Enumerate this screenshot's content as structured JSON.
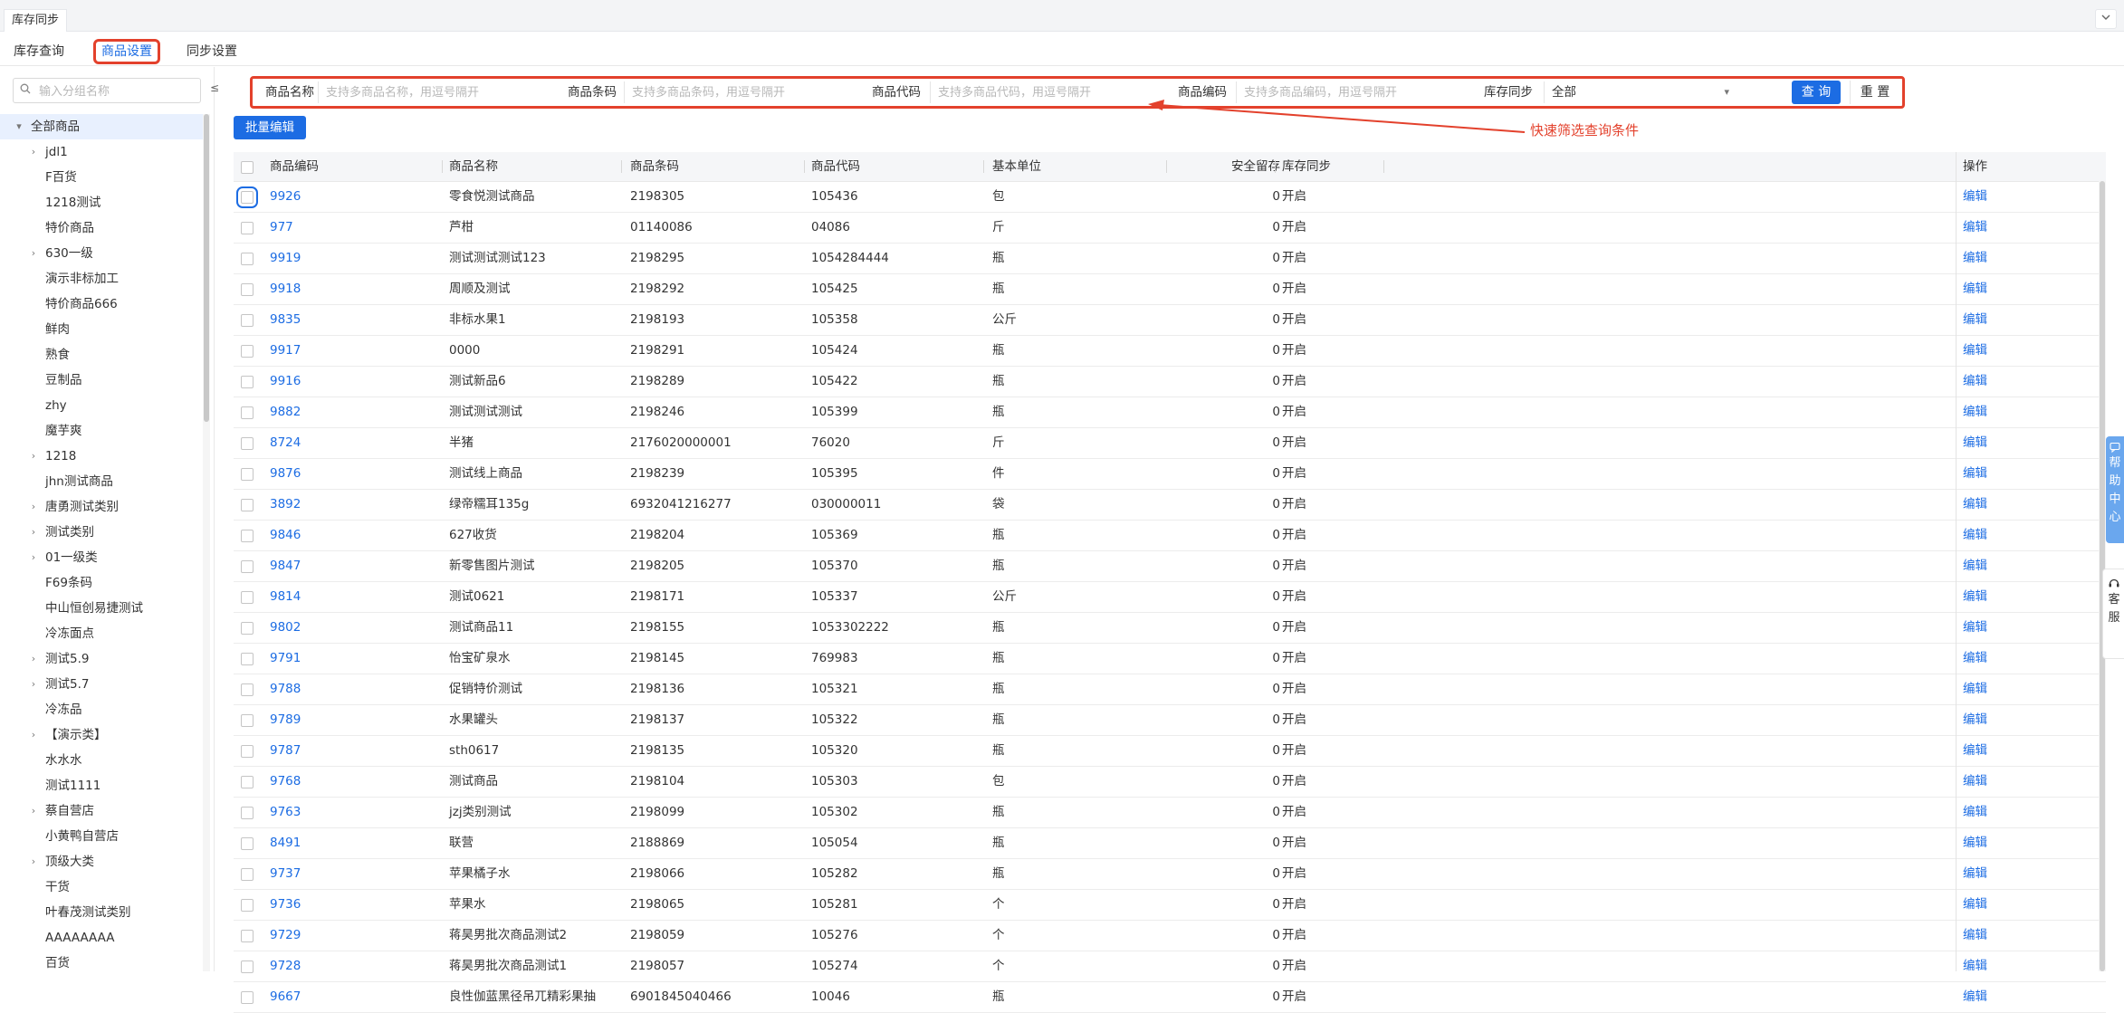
{
  "top_tab": "库存同步",
  "tabs": [
    "库存查询",
    "商品设置",
    "同步设置"
  ],
  "sidebar": {
    "search_placeholder": "输入分组名称",
    "toggle_label": "≤",
    "root": "全部商品",
    "groups": [
      {
        "label": "jdl1",
        "expandable": true
      },
      {
        "label": "F百货",
        "expandable": false
      },
      {
        "label": "1218测试",
        "expandable": false
      },
      {
        "label": "特价商品",
        "expandable": false
      },
      {
        "label": "630一级",
        "expandable": true
      },
      {
        "label": "演示非标加工",
        "expandable": false
      },
      {
        "label": "特价商品666",
        "expandable": false
      },
      {
        "label": "鲜肉",
        "expandable": false
      },
      {
        "label": "熟食",
        "expandable": false
      },
      {
        "label": "豆制品",
        "expandable": false
      },
      {
        "label": "zhy",
        "expandable": false
      },
      {
        "label": "魔芋爽",
        "expandable": false
      },
      {
        "label": "1218",
        "expandable": true
      },
      {
        "label": "jhn测试商品",
        "expandable": false
      },
      {
        "label": "唐勇测试类别",
        "expandable": true
      },
      {
        "label": "测试类别",
        "expandable": true
      },
      {
        "label": "01一级类",
        "expandable": true
      },
      {
        "label": "F69条码",
        "expandable": false
      },
      {
        "label": "中山恒创易捷测试",
        "expandable": false
      },
      {
        "label": "冷冻面点",
        "expandable": false
      },
      {
        "label": "测试5.9",
        "expandable": true
      },
      {
        "label": "测试5.7",
        "expandable": true
      },
      {
        "label": "冷冻品",
        "expandable": false
      },
      {
        "label": "【演示类】",
        "expandable": true
      },
      {
        "label": "水水水",
        "expandable": false
      },
      {
        "label": "测试1111",
        "expandable": false
      },
      {
        "label": "蔡自营店",
        "expandable": true
      },
      {
        "label": "小黄鸭自营店",
        "expandable": false
      },
      {
        "label": "顶级大类",
        "expandable": true
      },
      {
        "label": "干货",
        "expandable": false
      },
      {
        "label": "叶春茂测试类别",
        "expandable": false
      },
      {
        "label": "AAAAAAAA",
        "expandable": false
      },
      {
        "label": "百货",
        "expandable": false
      }
    ]
  },
  "filters": {
    "name_label": "商品名称",
    "name_placeholder": "支持多商品名称，用逗号隔开",
    "barcode_label": "商品条码",
    "barcode_placeholder": "支持多商品条码，用逗号隔开",
    "code_label": "商品代码",
    "code_placeholder": "支持多商品代码，用逗号隔开",
    "number_label": "商品编码",
    "number_placeholder": "支持多商品编码，用逗号隔开",
    "sync_label": "库存同步",
    "sync_value": "全部",
    "query_label": "查 询",
    "reset_label": "重 置"
  },
  "annotation": "快速筛选查询条件",
  "batch_edit_label": "批量编辑",
  "table": {
    "columns": [
      "商品编码",
      "商品名称",
      "商品条码",
      "商品代码",
      "基本单位",
      "安全留存",
      "库存同步",
      "操作"
    ],
    "edit_label": "编辑",
    "rows": [
      [
        "9926",
        "零食悦测试商品",
        "2198305",
        "105436",
        "包",
        "0",
        "开启"
      ],
      [
        "977",
        "芦柑",
        "01140086",
        "04086",
        "斤",
        "0",
        "开启"
      ],
      [
        "9919",
        "测试测试测试123",
        "2198295",
        "1054284444",
        "瓶",
        "0",
        "开启"
      ],
      [
        "9918",
        "周顺及测试",
        "2198292",
        "105425",
        "瓶",
        "0",
        "开启"
      ],
      [
        "9835",
        "非标水果1",
        "2198193",
        "105358",
        "公斤",
        "0",
        "开启"
      ],
      [
        "9917",
        "0000",
        "2198291",
        "105424",
        "瓶",
        "0",
        "开启"
      ],
      [
        "9916",
        "测试新品6",
        "2198289",
        "105422",
        "瓶",
        "0",
        "开启"
      ],
      [
        "9882",
        "测试测试测试",
        "2198246",
        "105399",
        "瓶",
        "0",
        "开启"
      ],
      [
        "8724",
        "半猪",
        "2176020000001",
        "76020",
        "斤",
        "0",
        "开启"
      ],
      [
        "9876",
        "测试线上商品",
        "2198239",
        "105395",
        "件",
        "0",
        "开启"
      ],
      [
        "3892",
        "绿帝糯耳135g",
        "6932041216277",
        "030000011",
        "袋",
        "0",
        "开启"
      ],
      [
        "9846",
        "627收货",
        "2198204",
        "105369",
        "瓶",
        "0",
        "开启"
      ],
      [
        "9847",
        "新零售图片测试",
        "2198205",
        "105370",
        "瓶",
        "0",
        "开启"
      ],
      [
        "9814",
        "测试0621",
        "2198171",
        "105337",
        "公斤",
        "0",
        "开启"
      ],
      [
        "9802",
        "测试商品11",
        "2198155",
        "1053302222",
        "瓶",
        "0",
        "开启"
      ],
      [
        "9791",
        "怡宝矿泉水",
        "2198145",
        "769983",
        "瓶",
        "0",
        "开启"
      ],
      [
        "9788",
        "促销特价测试",
        "2198136",
        "105321",
        "瓶",
        "0",
        "开启"
      ],
      [
        "9789",
        "水果罐头",
        "2198137",
        "105322",
        "瓶",
        "0",
        "开启"
      ],
      [
        "9787",
        "sth0617",
        "2198135",
        "105320",
        "瓶",
        "0",
        "开启"
      ],
      [
        "9768",
        "测试商品",
        "2198104",
        "105303",
        "包",
        "0",
        "开启"
      ],
      [
        "9763",
        "jzj类别测试",
        "2198099",
        "105302",
        "瓶",
        "0",
        "开启"
      ],
      [
        "8491",
        "联营",
        "2188869",
        "105054",
        "瓶",
        "0",
        "开启"
      ],
      [
        "9737",
        "苹果橘子水",
        "2198066",
        "105282",
        "瓶",
        "0",
        "开启"
      ],
      [
        "9736",
        "苹果水",
        "2198065",
        "105281",
        "个",
        "0",
        "开启"
      ],
      [
        "9729",
        "蒋昊男批次商品测试2",
        "2198059",
        "105276",
        "个",
        "0",
        "开启"
      ],
      [
        "9728",
        "蒋昊男批次商品测试1",
        "2198057",
        "105274",
        "个",
        "0",
        "开启"
      ],
      [
        "9667",
        "良性伽蓝黑径吊兀精彩果抽",
        "6901845040466",
        "10046",
        "瓶",
        "0",
        "开启"
      ]
    ]
  },
  "help_center_label": "帮助中心",
  "customer_service_label": "客服"
}
